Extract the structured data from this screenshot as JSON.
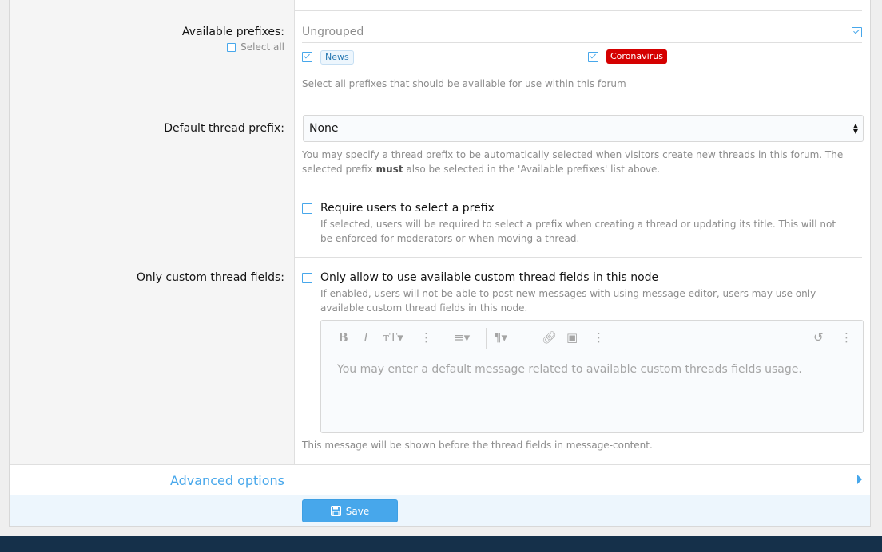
{
  "prefixes": {
    "label": "Available prefixes:",
    "select_all": "Select all",
    "group_name": "Ungrouped",
    "items": [
      {
        "label": "News",
        "checked": true
      },
      {
        "label": "Coronavirus",
        "checked": true,
        "color": "#d50000"
      }
    ],
    "hint": "Select all prefixes that should be available for use within this forum"
  },
  "default_prefix": {
    "label": "Default thread prefix:",
    "value": "None",
    "hint_part1": "You may specify a thread prefix to be automatically selected when visitors create new threads in this forum. The selected prefix ",
    "hint_bold": "must",
    "hint_part2": " also be selected in the 'Available prefixes' list above."
  },
  "require_prefix": {
    "label": "Require users to select a prefix",
    "checked": false,
    "hint": "If selected, users will be required to select a prefix when creating a thread or updating its title. This will not be enforced for moderators or when moving a thread."
  },
  "custom_fields": {
    "label": "Only custom thread fields:",
    "option_label": "Only allow to use available custom thread fields in this node",
    "checked": false,
    "hint": "If enabled, users will not be able to post new messages with using message editor, users may use only available custom thread fields in this node.",
    "editor_placeholder": "You may enter a default message related to available custom threads fields usage.",
    "editor_hint": "This message will be shown before the thread fields in message-content."
  },
  "advanced": {
    "label": "Advanced options"
  },
  "save": {
    "label": "Save"
  },
  "colors": {
    "accent": "#47a7eb",
    "footer": "#15304a"
  }
}
